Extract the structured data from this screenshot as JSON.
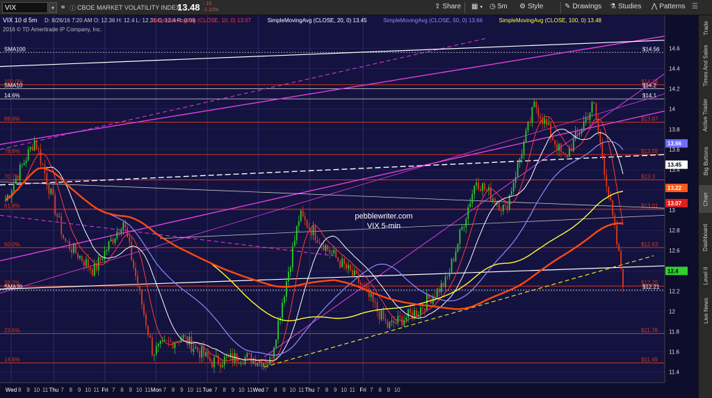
{
  "toolbar": {
    "symbol": "VIX",
    "description": "CBOE MARKET VOLATILITY INDEX",
    "last": "13.48",
    "change": "-.15",
    "change_pct": "-1.10%",
    "buttons": [
      {
        "label": "Share",
        "icon": "share-icon"
      },
      {
        "label": "5m",
        "icon": "clock-icon"
      },
      {
        "label": "Style",
        "icon": "gear-icon"
      },
      {
        "label": "Drawings",
        "icon": "pencil-icon"
      },
      {
        "label": "Studies",
        "icon": "flask-icon"
      },
      {
        "label": "Patterns",
        "icon": "chart-pattern-icon"
      }
    ]
  },
  "chart_header": {
    "main": "VIX 10 d 5m",
    "ohlc": "D: 8/26/16 7:20 AM   O: 12.36   H: 12.4   L: 12.31   C: 12.4   R: 0.09",
    "studies": [
      {
        "label": "SimpleMovingAvg (CLOSE, 10, 0)",
        "value": "13.07",
        "color": "#ff3a3a"
      },
      {
        "label": "SimpleMovingAvg (CLOSE, 20, 0)",
        "value": "13.45",
        "color": "#ffffff"
      },
      {
        "label": "SimpleMovingAvg (CLOSE, 50, 0)",
        "value": "13.66",
        "color": "#8f8cff"
      },
      {
        "label": "SimpleMovingAvg (CLOSE, 100, 0)",
        "value": "13.48",
        "color": "#ffff33"
      }
    ],
    "copyright": "2016 © TD Ameritrade IP Company, Inc."
  },
  "watermark": {
    "line1": "pebblewriter.com",
    "line2": "VIX 5-min"
  },
  "sidebar": {
    "tabs": [
      "Trade",
      "Times And Sales",
      "Active Trader",
      "Big Buttons",
      "Chart",
      "Dashboard",
      "Level II",
      "Live News"
    ],
    "active": "Chart"
  },
  "fib_levels": [
    {
      "pct": "100.0%",
      "price": "$14.24",
      "y": 14.24
    },
    {
      "pct": "88.6%",
      "price": "$13.87",
      "y": 13.87
    },
    {
      "pct": "78.6%",
      "price": "$13.55",
      "y": 13.55
    },
    {
      "pct": "70.7%",
      "price": "$13.3",
      "y": 13.3
    },
    {
      "pct": "61.8%",
      "price": "$13.01",
      "y": 13.01
    },
    {
      "pct": "50.0%",
      "price": "$12.63",
      "y": 12.63
    },
    {
      "pct": "38.2%",
      "price": "$12.25",
      "y": 12.25
    },
    {
      "pct": "23.6%",
      "price": "$11.78",
      "y": 11.78
    },
    {
      "pct": "14.6%",
      "price": "$11.49",
      "y": 11.49
    }
  ],
  "white_levels": [
    {
      "label": "SMA100",
      "price": "$14.56",
      "y": 14.56
    },
    {
      "label": "SMA10",
      "price": "$14.2",
      "y": 14.2
    },
    {
      "label": "14.6%",
      "price": "$14.1",
      "y": 14.1
    },
    {
      "label": "SMA20",
      "price": "$12.21",
      "y": 12.21
    }
  ],
  "price_tags": [
    {
      "value": "13.66",
      "y": 13.66,
      "bg": "#6e6cff",
      "fg": "#ffffff"
    },
    {
      "value": "13.45",
      "y": 13.45,
      "bg": "#ffffff",
      "fg": "#000000"
    },
    {
      "value": "13.22",
      "y": 13.22,
      "bg": "#ff5a1a",
      "fg": "#ffffff"
    },
    {
      "value": "13.07",
      "y": 13.07,
      "bg": "#e02020",
      "fg": "#ffffff"
    },
    {
      "value": "12.4",
      "y": 12.4,
      "bg": "#2fcf2f",
      "fg": "#000000"
    }
  ],
  "axis": {
    "y_ticks": [
      "14.6",
      "14.4",
      "14.2",
      "14",
      "13.8",
      "13.6",
      "13.4",
      "13.2",
      "13",
      "12.8",
      "12.6",
      "12.4",
      "12.2",
      "12",
      "11.8",
      "11.6",
      "11.4"
    ],
    "ylim": [
      11.35,
      14.72
    ],
    "x_ticks": [
      {
        "label": "Wed",
        "day": true
      },
      {
        "label": "8"
      },
      {
        "label": "9"
      },
      {
        "label": "10"
      },
      {
        "label": "11"
      },
      {
        "label": "Thu",
        "day": true
      },
      {
        "label": "7"
      },
      {
        "label": "8"
      },
      {
        "label": "9"
      },
      {
        "label": "10"
      },
      {
        "label": "11"
      },
      {
        "label": "Fri",
        "day": true
      },
      {
        "label": "7"
      },
      {
        "label": "8"
      },
      {
        "label": "9"
      },
      {
        "label": "10"
      },
      {
        "label": "11"
      },
      {
        "label": "Mon",
        "day": true
      },
      {
        "label": "7"
      },
      {
        "label": "8"
      },
      {
        "label": "9"
      },
      {
        "label": "10"
      },
      {
        "label": "11"
      },
      {
        "label": "Tue",
        "day": true
      },
      {
        "label": "7"
      },
      {
        "label": "8"
      },
      {
        "label": "9"
      },
      {
        "label": "10"
      },
      {
        "label": "11"
      },
      {
        "label": "Wed",
        "day": true
      },
      {
        "label": "7"
      },
      {
        "label": "8"
      },
      {
        "label": "9"
      },
      {
        "label": "10"
      },
      {
        "label": "11"
      },
      {
        "label": "Thu",
        "day": true
      },
      {
        "label": "7"
      },
      {
        "label": "8"
      },
      {
        "label": "9"
      },
      {
        "label": "10"
      },
      {
        "label": "11"
      },
      {
        "label": "Fri",
        "day": true
      },
      {
        "label": "7"
      },
      {
        "label": "8"
      },
      {
        "label": "9"
      },
      {
        "label": "10"
      }
    ]
  },
  "colors": {
    "background": "#14123f",
    "grid": "#2a2860",
    "fib": "#d23a1c",
    "up_candle": "#2ecc2e",
    "down_candle": "#e03a1c",
    "channel_magenta": "#e040e0",
    "trend_yellow": "#e6e628"
  },
  "chart_data": {
    "type": "candlestick",
    "symbol": "VIX",
    "interval": "5m",
    "period": "10 d",
    "ylim": [
      11.35,
      14.72
    ],
    "session_close": [
      13.3,
      12.9,
      11.6,
      11.55,
      11.5,
      12.6,
      11.85,
      12.25,
      13.5,
      13.6,
      12.4
    ],
    "sma_values": {
      "sma10": 13.07,
      "sma20": 13.45,
      "sma50": 13.66,
      "sma100": 13.48
    },
    "last": 12.4
  }
}
